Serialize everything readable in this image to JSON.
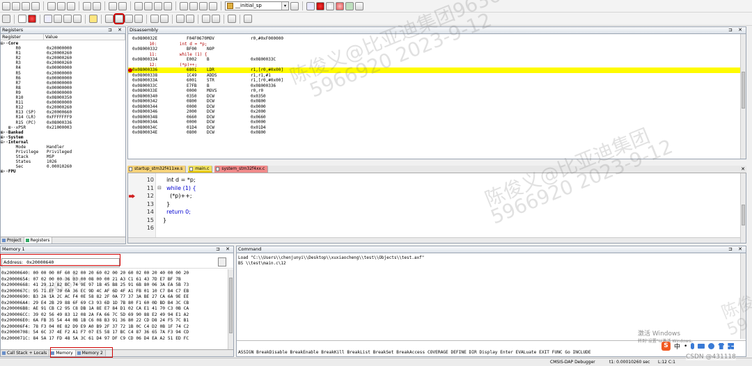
{
  "toolbar1": {
    "target_combo": "__initial_sp",
    "icons": [
      "new-file-icon",
      "open-icon",
      "save-icon",
      "save-all-icon",
      "cut-icon",
      "copy-icon",
      "paste-icon",
      "undo-icon",
      "redo-icon",
      "back-icon",
      "forward-icon",
      "bookmark-icon",
      "prev-bookmark-icon",
      "next-bookmark-icon",
      "clear-bookmarks-icon",
      "indent-icon",
      "unindent-icon",
      "comment-icon",
      "uncomment-icon",
      "find-icon",
      "breakpoint-icon",
      "clear-breakpoint-icon",
      "enable-bp-icon",
      "disable-bp-icon",
      "window-icon",
      "tools-icon"
    ]
  },
  "toolbar2": {
    "icons": [
      "reset-icon",
      "run-icon",
      "stop-icon",
      "step-icon",
      "step-over-icon",
      "step-out-icon",
      "run-to-cursor-icon",
      "show-next-icon",
      "command-window-icon",
      "disassembly-window-icon",
      "symbols-window-icon",
      "registers-window-icon",
      "call-stack-icon",
      "watch-window-icon",
      "memory-window-icon",
      "serial-window-icon",
      "analysis-window-icon",
      "trace-window-icon",
      "system-viewer-icon",
      "toolbox-icon"
    ]
  },
  "registers": {
    "title": "Registers",
    "col_register": "Register",
    "col_value": "Value",
    "rows": [
      {
        "name": "⊟··Core",
        "value": "",
        "bold": true
      },
      {
        "name": "      R0",
        "value": "0x20000000"
      },
      {
        "name": "      R1",
        "value": "0x20000260"
      },
      {
        "name": "      R2",
        "value": "0x20000260"
      },
      {
        "name": "      R3",
        "value": "0x20000260"
      },
      {
        "name": "      R4",
        "value": "0x00000000"
      },
      {
        "name": "      R5",
        "value": "0x20000000"
      },
      {
        "name": "      R6",
        "value": "0x00000000"
      },
      {
        "name": "      R7",
        "value": "0x00000000"
      },
      {
        "name": "      R8",
        "value": "0x00000000"
      },
      {
        "name": "      R9",
        "value": "0x00000000"
      },
      {
        "name": "      R10",
        "value": "0x08000350"
      },
      {
        "name": "      R11",
        "value": "0x00000000"
      },
      {
        "name": "      R12",
        "value": "0x20000260"
      },
      {
        "name": "      R13 (SP)",
        "value": "0x20000660"
      },
      {
        "name": "      R14 (LR)",
        "value": "0xFFFFFFF9"
      },
      {
        "name": "      R15 (PC)",
        "value": "0x08000336"
      },
      {
        "name": "   ⊞··xPSR",
        "value": "0x21000003"
      },
      {
        "name": "⊞··Banked",
        "value": "",
        "bold": true
      },
      {
        "name": "⊞··System",
        "value": "",
        "bold": true
      },
      {
        "name": "⊟··Internal",
        "value": "",
        "bold": true
      },
      {
        "name": "      Mode",
        "value": "Handler"
      },
      {
        "name": "      Privilege",
        "value": "Privileged"
      },
      {
        "name": "      Stack",
        "value": "MSP"
      },
      {
        "name": "      States",
        "value": "1026"
      },
      {
        "name": "      Sec",
        "value": "0.00010260"
      },
      {
        "name": "⊞··FPU",
        "value": "",
        "bold": true
      }
    ],
    "tab_project": "Project",
    "tab_registers": "Registers"
  },
  "disassembly": {
    "title": "Disassembly",
    "rows": [
      {
        "addr": "0x0800032E",
        "op": "F04F0670",
        "mn": "MOV",
        "args": "r0,#0xF000000",
        "type": "asm"
      },
      {
        "src": "    10:         int d = *p;",
        "type": "src"
      },
      {
        "addr": "0x08000332",
        "op": "BF00",
        "mn": "NOP",
        "args": "",
        "type": "asm"
      },
      {
        "src": "    11:         while (1) {",
        "type": "src"
      },
      {
        "addr": "0x08000334",
        "op": "E002",
        "mn": "B",
        "args": "0x0800033C",
        "type": "asm"
      },
      {
        "src": "    12:         (*p)++;",
        "type": "src"
      },
      {
        "addr": "0x08000336",
        "op": "6801",
        "mn": "LDR",
        "args": "r1,[r0,#0x00]",
        "type": "cur"
      },
      {
        "addr": "0x08000338",
        "op": "1C49",
        "mn": "ADDS",
        "args": "r1,r1,#1",
        "type": "asm"
      },
      {
        "addr": "0x0800033A",
        "op": "6001",
        "mn": "STR",
        "args": "r1,[r0,#0x00]",
        "type": "asm"
      },
      {
        "addr": "0x0800033C",
        "op": "E7FB",
        "mn": "B",
        "args": "0x08000336",
        "type": "asm"
      },
      {
        "addr": "0x0800033E",
        "op": "0000",
        "mn": "MOVS",
        "args": "r0,r0",
        "type": "asm"
      },
      {
        "addr": "0x08000340",
        "op": "0350",
        "mn": "DCW",
        "args": "0x0350",
        "type": "asm"
      },
      {
        "addr": "0x08000342",
        "op": "0800",
        "mn": "DCW",
        "args": "0x0800",
        "type": "asm"
      },
      {
        "addr": "0x08000344",
        "op": "0000",
        "mn": "DCW",
        "args": "0x0000",
        "type": "asm"
      },
      {
        "addr": "0x08000346",
        "op": "2000",
        "mn": "DCW",
        "args": "0x2000",
        "type": "asm"
      },
      {
        "addr": "0x08000348",
        "op": "0660",
        "mn": "DCW",
        "args": "0x0660",
        "type": "asm"
      },
      {
        "addr": "0x0800034A",
        "op": "0000",
        "mn": "DCW",
        "args": "0x0000",
        "type": "asm"
      },
      {
        "addr": "0x0800034C",
        "op": "01D4",
        "mn": "DCW",
        "args": "0x01D4",
        "type": "asm"
      },
      {
        "addr": "0x0800034E",
        "op": "0800",
        "mn": "DCW",
        "args": "0x0800",
        "type": "asm"
      }
    ]
  },
  "editor": {
    "tabs": [
      "startup_stm32f411xe.s",
      "main.c",
      "system_stm32f4xx.c"
    ],
    "lines": [
      {
        "n": "10",
        "code": "  int d = *p;",
        "fold": ""
      },
      {
        "n": "11",
        "code": "  while (1) {",
        "fold": "⊟"
      },
      {
        "n": "12",
        "code": "    (*p)++;",
        "fold": ""
      },
      {
        "n": "13",
        "code": "  }",
        "fold": ""
      },
      {
        "n": "14",
        "code": "  return 0;",
        "fold": ""
      },
      {
        "n": "15",
        "code": "}",
        "fold": ""
      },
      {
        "n": "16",
        "code": "",
        "fold": ""
      }
    ]
  },
  "memory": {
    "title": "Memory 1",
    "address_label": "Address:",
    "address_value": "0x20000640",
    "rows": [
      "0x20000640: 00 00 00 0F 60 02 00 20 60 02 00 20 60 02 00 20 40 00 00 20",
      "0x20000654: 07 02 00 00 36 03 00 08 00 00 21 A3 C1 61 43 7D E7 BF 7B",
      "0x20000668: 41 29 12 82 BC 74 9E 97 1B 45 B8 25 91 6B 80 06 3A EA 5B 73",
      "0x2000067C: 95 71 EF 70 0A 36 EC 9D 4C AF 6D 4F A1 FB 01 10 C7 B4 C7 EB",
      "0x20000690: B3 2A 1A 2C AC F4 0E 58 82 2F 0A 77 37 3A BE 27 CA 6A 9E EE",
      "0x200006A4: 29 E4 2B 29 88 6F 69 C3 93 6D 1D 7B 80 F1 60 0D BD B4 3C CB",
      "0x200006B8: AE 91 CB C2 95 C8 DB 1A 8E E7 84 D1 02 CA E1 41 70 C3 0B CA",
      "0x200006CC: 39 02 56 49 83 12 08 2A FA 66 7C 5D 69 90 88 E2 49 94 E1 A2",
      "0x200006E0: 6A FB 35 54 44 0B 1B C6 08 B3 91 36 80 22 CD D8 24 F5 7C B1",
      "0x200006F4: 78 F3 04 0E 82 D9 E9 A0 B9 2F 37 72 1B 0C C4 D2 0B 1F 74 C2",
      "0x20000708: 54 6C 37 4E F2 A1 F7 07 E5 58 17 BC C4 87 36 65 7A F3 94 CD",
      "0x2000071C: 84 5A 17 FD 48 5A 3C 61 D4 97 DF C9 CD 06 D4 EA A2 51 ED FC"
    ],
    "tab_callstack": "Call Stack + Locals",
    "tab_memory": "Memory",
    "tab_memory2": "Memory 2"
  },
  "command": {
    "title": "Command",
    "lines": [
      "Load \"C:\\\\Users\\\\chenjunyi\\\\Desktop\\\\xuxiaocheng\\\\test\\\\Objects\\\\test.axf\"",
      "BS \\\\test\\main.c\\12"
    ],
    "autocomplete": "ASSIGN BreakDisable BreakEnable BreakKill BreakList BreakSet BreakAccess COVERAGE DEFINE DIR Display Enter EVALuate EXIT FUNC Go INCLUDE"
  },
  "statusbar": {
    "debugger": "CMSIS-DAP Debugger",
    "time": "t1: 0.00010260 sec",
    "position": "L:12 C:1"
  },
  "watermark": {
    "line1": "陈俊义@比亚迪集团9636",
    "line2": "5966920 2023-9-12",
    "line3": "陈俊义@比亚迪集团",
    "line4": "5966920 2023-9-12",
    "line5": "陈俊义",
    "line6": "59"
  },
  "taskbar": {
    "activate_title": "激活 Windows",
    "activate_sub": "转到\"设置\"以激活 Windows。",
    "ime": "中",
    "csdn": "CSDN @431118"
  }
}
